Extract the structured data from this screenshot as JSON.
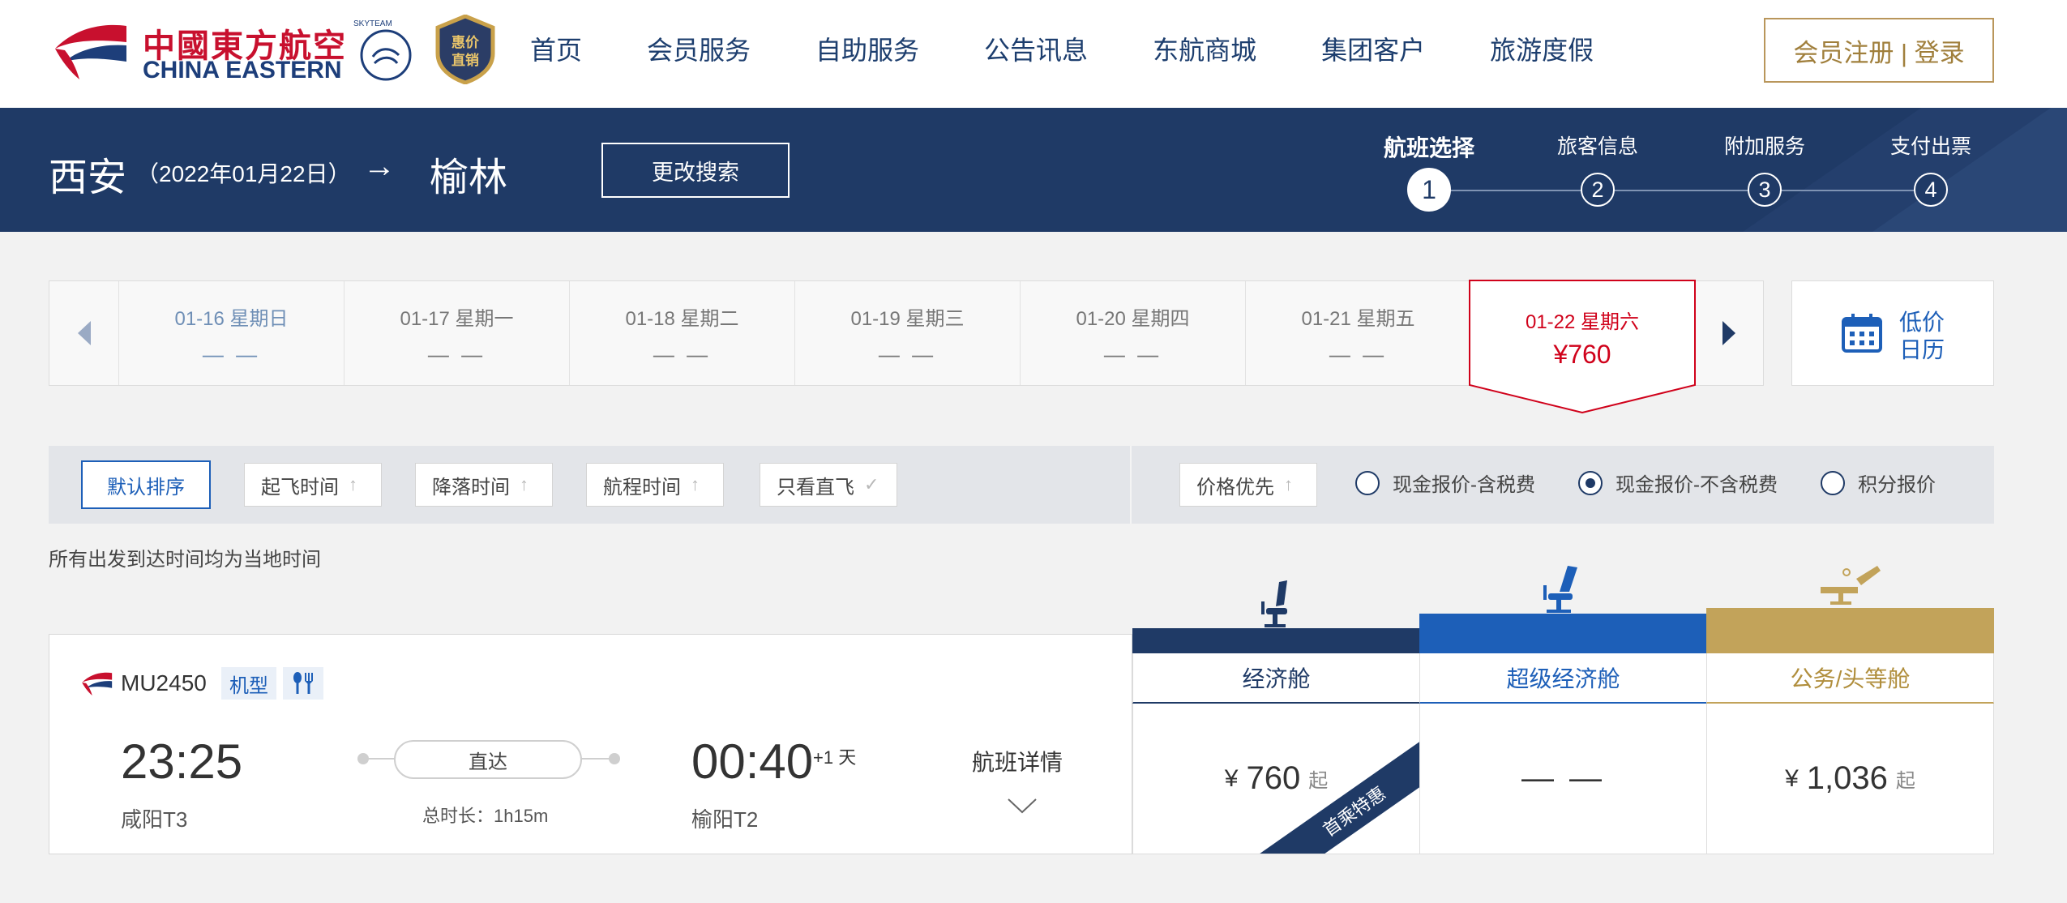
{
  "brand": {
    "name_cn": "中國東方航空",
    "name_en": "CHINA EASTERN",
    "badge": "惠价直销",
    "alliance": "SKYTEAM"
  },
  "nav": [
    "首页",
    "会员服务",
    "自助服务",
    "公告讯息",
    "东航商城",
    "集团客户",
    "旅游度假"
  ],
  "login": "会员注册 | 登录",
  "route": {
    "from": "西安",
    "date": "（2022年01月22日）",
    "arrow": "→",
    "to": "榆林",
    "change": "更改搜索"
  },
  "steps": [
    {
      "label": "航班选择",
      "num": "1"
    },
    {
      "label": "旅客信息",
      "num": "2"
    },
    {
      "label": "附加服务",
      "num": "3"
    },
    {
      "label": "支付出票",
      "num": "4"
    }
  ],
  "dates": [
    {
      "day": "01-16 星期日",
      "price": "— —"
    },
    {
      "day": "01-17 星期一",
      "price": "— —"
    },
    {
      "day": "01-18 星期二",
      "price": "— —"
    },
    {
      "day": "01-19 星期三",
      "price": "— —"
    },
    {
      "day": "01-20 星期四",
      "price": "— —"
    },
    {
      "day": "01-21 星期五",
      "price": "— —"
    }
  ],
  "active_date": {
    "day": "01-22 星期六",
    "price": "¥760"
  },
  "calendar": {
    "label": "低价日历"
  },
  "filters": {
    "default": "默认排序",
    "sorts": [
      "起飞时间",
      "降落时间",
      "航程时间",
      "只看直飞",
      "价格优先"
    ],
    "radios": [
      {
        "label": "现金报价-含税费",
        "checked": false
      },
      {
        "label": "现金报价-不含税费",
        "checked": true
      },
      {
        "label": "积分报价",
        "checked": false
      }
    ]
  },
  "notice": "所有出发到达时间均为当地时间",
  "cabins": [
    {
      "name": "经济舱",
      "color": "#1f3a66"
    },
    {
      "name": "超级经济舱",
      "color": "#1d5fb8"
    },
    {
      "name": "公务/头等舱",
      "color": "#c2a35a"
    }
  ],
  "flight": {
    "number": "MU2450",
    "aircraft_tag": "机型",
    "dep_time": "23:25",
    "dep_airport": "咸阳T3",
    "type": "直达",
    "duration": "总时长：1h15m",
    "arr_time": "00:40",
    "arr_plus": "+1 天",
    "arr_airport": "榆阳T2",
    "detail": "航班详情",
    "prices": {
      "economy": {
        "currency": "¥",
        "amount": "760",
        "suffix": "起",
        "ribbon": "首乘特惠"
      },
      "premium": {
        "dash": "— —"
      },
      "business": {
        "currency": "¥",
        "amount": "1,036",
        "suffix": "起"
      }
    }
  }
}
